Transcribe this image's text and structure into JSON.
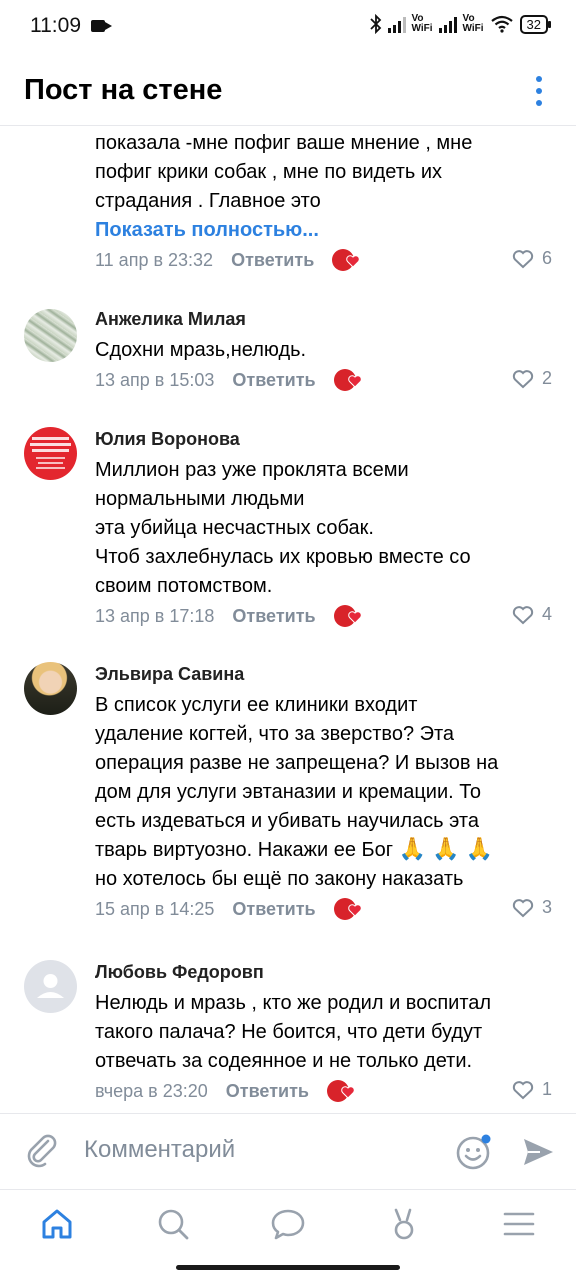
{
  "status_bar": {
    "time": "11:09",
    "vo_wifi_1": "Vo\nWiFi",
    "vo_wifi_2": "Vo\nWiFi",
    "battery": "32"
  },
  "header": {
    "title": "Пост на стене",
    "more_icon": "more-vertical-icon"
  },
  "comments": [
    {
      "name": "",
      "text": "показала -мне пофиг ваше мнение , мне\nпофиг крики собак , мне по видеть их\nстрадания . Главное это",
      "show_more": "Показать полностью...",
      "date": "11 апр в 23:32",
      "reply": "Ответить",
      "likes": "6"
    },
    {
      "name": "Анжелика Милая",
      "text": "Сдохни мразь,нелюдь.",
      "date": "13 апр в 15:03",
      "reply": "Ответить",
      "likes": "2"
    },
    {
      "name": "Юлия Воронова",
      "text": "Миллион раз уже проклята всеми\nнормальными людьми\nэта убийца несчастных собак.\nЧтоб захлебнулась их кровью вместе со\nсвоим потомством.",
      "date": "13 апр в 17:18",
      "reply": "Ответить",
      "likes": "4"
    },
    {
      "name": "Эльвира Савина",
      "text_main": "В список услуги ее клиники входит\nудаление когтей, что за зверство? Эта\nоперация разве не запрещена? И вызов на\nдом для услуги эвтаназии и кремации. То\nесть издеваться и убивать научилась эта\nтварь виртуозно. Накажи ее Бог",
      "emoji": "🙏 🙏 🙏",
      "text_end": "но хотелось бы ещё по закону наказать",
      "date": "15 апр в 14:25",
      "reply": "Ответить",
      "likes": "3"
    },
    {
      "name": "Любовь Федоровп",
      "text": "Нелюдь и мразь , кто же родил и воспитал\nтакого палача? Не боится, что дети будут\nотвечать за содеянное и не только дети.",
      "date": "вчера в 23:20",
      "reply": "Ответить",
      "likes": "1"
    }
  ],
  "input_bar": {
    "placeholder": "Комментарий",
    "attach_icon": "paperclip-icon",
    "emoji_icon": "smile-icon",
    "send_icon": "send-icon"
  },
  "bottom_nav": [
    "home-icon",
    "search-icon",
    "messages-icon",
    "clips-icon",
    "menu-icon"
  ],
  "colors": {
    "accent": "#2d81e0",
    "secondary_text": "#818c99",
    "divider": "#e7e8ec"
  }
}
